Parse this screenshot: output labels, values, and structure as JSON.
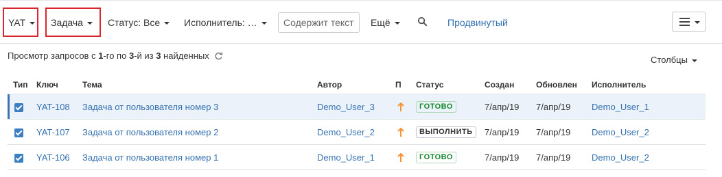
{
  "filters": {
    "project": "YAT",
    "type": "Задача",
    "status": "Статус: Все",
    "assignee": "Исполнитель: …",
    "search_placeholder": "Содержит текст",
    "more": "Ещё",
    "advanced": "Продвинутый"
  },
  "summary": {
    "prefix": "Просмотр запросов с ",
    "from": "1",
    "mid1": "-го по ",
    "to": "3",
    "mid2": "-й из ",
    "total": "3",
    "suffix": " найденных"
  },
  "columns_label": "Столбцы",
  "table": {
    "headers": {
      "type": "Тип",
      "key": "Ключ",
      "summary": "Тема",
      "reporter": "Автор",
      "priority": "П",
      "status": "Статус",
      "created": "Создан",
      "updated": "Обновлен",
      "assignee": "Исполнитель"
    },
    "rows": [
      {
        "key": "YAT-108",
        "summary": "Задача от пользователя номер 3",
        "reporter": "Demo_User_3",
        "status": "ГОТОВО",
        "created": "7/апр/19",
        "updated": "7/апр/19",
        "assignee": "Demo_User_1"
      },
      {
        "key": "YAT-107",
        "summary": "Задача от пользователя номер 2",
        "reporter": "Demo_User_2",
        "status": "ВЫПОЛНИТЬ",
        "created": "7/апр/19",
        "updated": "7/апр/19",
        "assignee": "Demo_User_2"
      },
      {
        "key": "YAT-106",
        "summary": "Задача от пользователя номер 1",
        "reporter": "Demo_User_1",
        "status": "ГОТОВО",
        "created": "7/апр/19",
        "updated": "7/апр/19",
        "assignee": "Demo_User_2"
      }
    ]
  },
  "colors": {
    "link": "#3572b0",
    "highlight": "#d9262b",
    "priority": "#f79232",
    "status_done": "#14892c"
  },
  "icons": {
    "refresh": "refresh-icon",
    "search": "search-icon",
    "menu": "hamburger-menu-icon",
    "priority": "arrow-up-icon",
    "issue_type": "checkbox-task-icon"
  }
}
